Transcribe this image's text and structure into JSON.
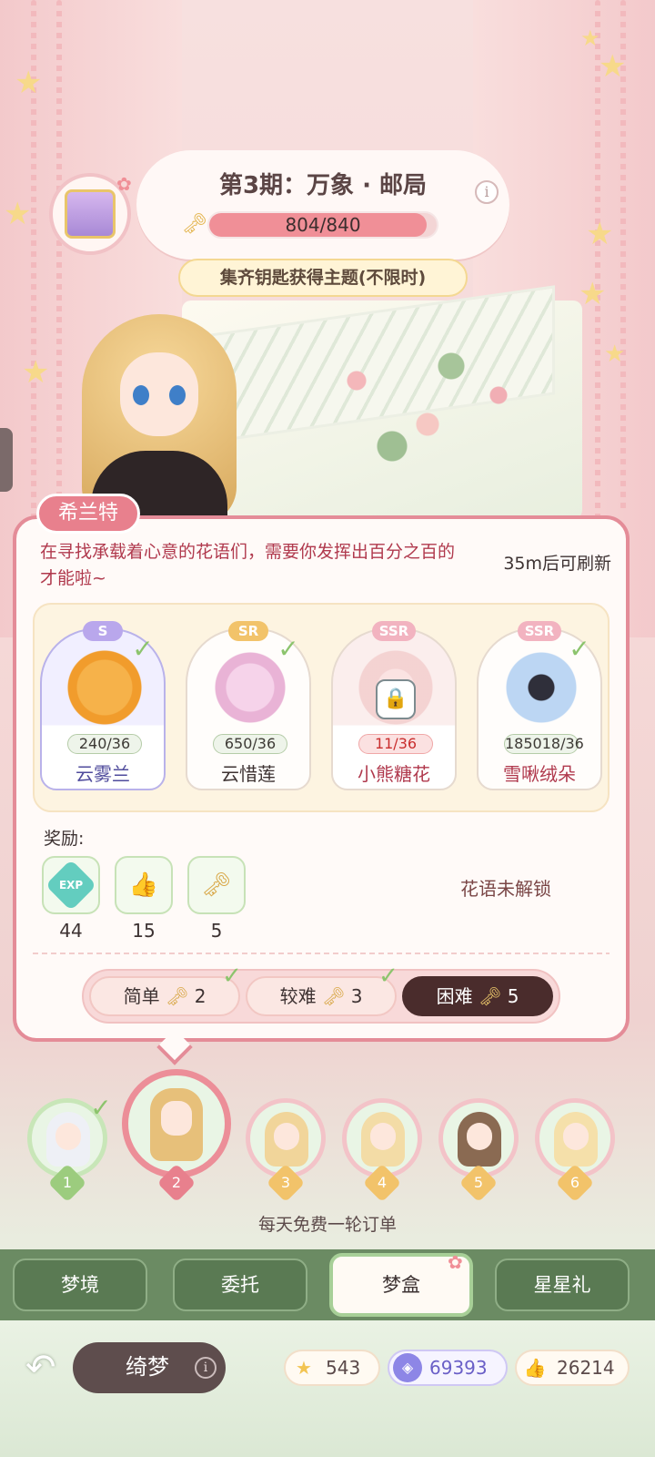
{
  "theme": {
    "title": "第3期：万象 · 邮局",
    "progress_text": "804/840",
    "progress_fraction": 0.957,
    "collect_banner": "集齐钥匙获得主题(不限时)"
  },
  "character": {
    "name": "希兰特"
  },
  "order": {
    "description": "在寻找承载着心意的花语们，需要你发挥出百分之百的才能啦~",
    "refresh": "35m后可刷新",
    "flowers": [
      {
        "rarity": "S",
        "count": "240/36",
        "name": "云雾兰",
        "checked": true,
        "locked": false
      },
      {
        "rarity": "SR",
        "count": "650/36",
        "name": "云惜莲",
        "checked": true,
        "locked": false
      },
      {
        "rarity": "SSR",
        "count": "11/36",
        "name": "小熊糖花",
        "checked": false,
        "locked": true
      },
      {
        "rarity": "SSR",
        "count": "185018/36",
        "name": "雪啾绒朵",
        "checked": true,
        "locked": false
      }
    ],
    "reward_label": "奖励:",
    "rewards": [
      {
        "icon": "exp-icon",
        "icon_text": "EXP",
        "amount": "44"
      },
      {
        "icon": "thumbs-up-icon",
        "icon_text": "👍",
        "amount": "15"
      },
      {
        "icon": "key-icon",
        "icon_text": "🗝",
        "amount": "5"
      }
    ],
    "unlock_text": "花语未解锁",
    "difficulties": [
      {
        "label": "简单",
        "keys": "2",
        "checked": true,
        "active": false
      },
      {
        "label": "较难",
        "keys": "3",
        "checked": true,
        "active": false
      },
      {
        "label": "困难",
        "keys": "5",
        "checked": false,
        "active": true
      }
    ]
  },
  "avatars": [
    {
      "number": "1",
      "done": true
    },
    {
      "number": "2",
      "done": false
    },
    {
      "number": "3",
      "done": false
    },
    {
      "number": "4",
      "done": false
    },
    {
      "number": "5",
      "done": false
    },
    {
      "number": "6",
      "done": false
    }
  ],
  "free_note": "每天免费一轮订单",
  "nav": {
    "items": [
      "梦境",
      "委托",
      "梦盒",
      "星星礼"
    ],
    "active_index": 2
  },
  "footer": {
    "page_label": "绮梦",
    "stars": "543",
    "gems": "69393",
    "likes": "26214"
  },
  "colors": {
    "accent": "#e8808d",
    "nav_green": "#6b8b63",
    "check_green": "#8cc46d",
    "active_difficulty": "#4a2c2c"
  }
}
